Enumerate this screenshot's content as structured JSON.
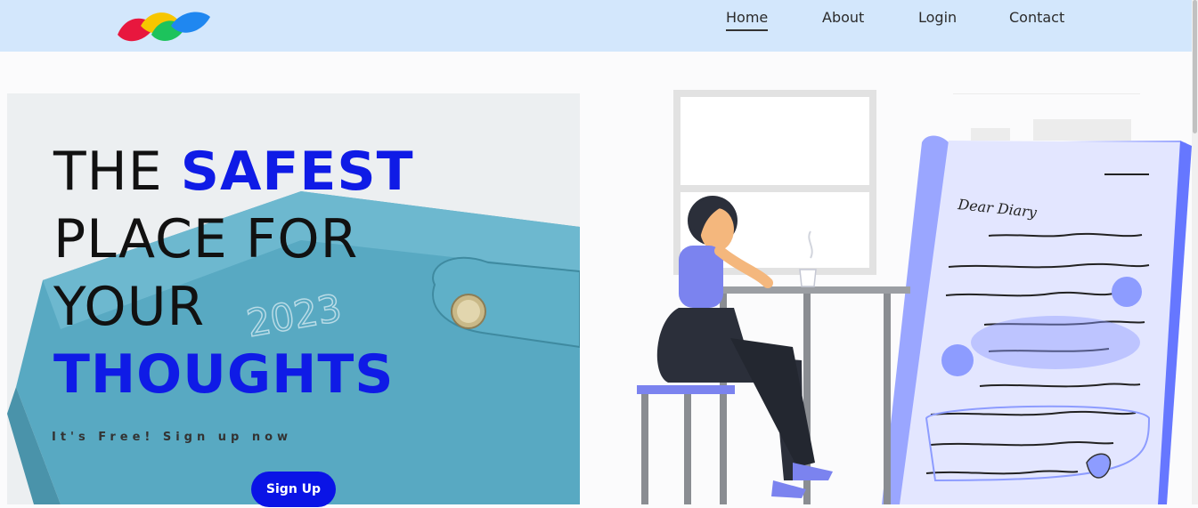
{
  "nav": {
    "items": [
      {
        "label": "Home",
        "active": true
      },
      {
        "label": "About",
        "active": false
      },
      {
        "label": "Login",
        "active": false
      },
      {
        "label": "Contact",
        "active": false
      }
    ]
  },
  "hero": {
    "headline": {
      "line1_a": "THE ",
      "line1_b": "SAFEST",
      "line2": "PLACE FOR",
      "line3": "YOUR",
      "line4": "THOUGHTS"
    },
    "tagline": "It's Free! Sign up now",
    "signup_label": "Sign Up",
    "diary_title": "Dear Diary",
    "notebook_year": "2023"
  },
  "colors": {
    "navbar_bg": "#d3e7fc",
    "accent_blue": "#0f1be6",
    "button_blue": "#0a14e6"
  }
}
